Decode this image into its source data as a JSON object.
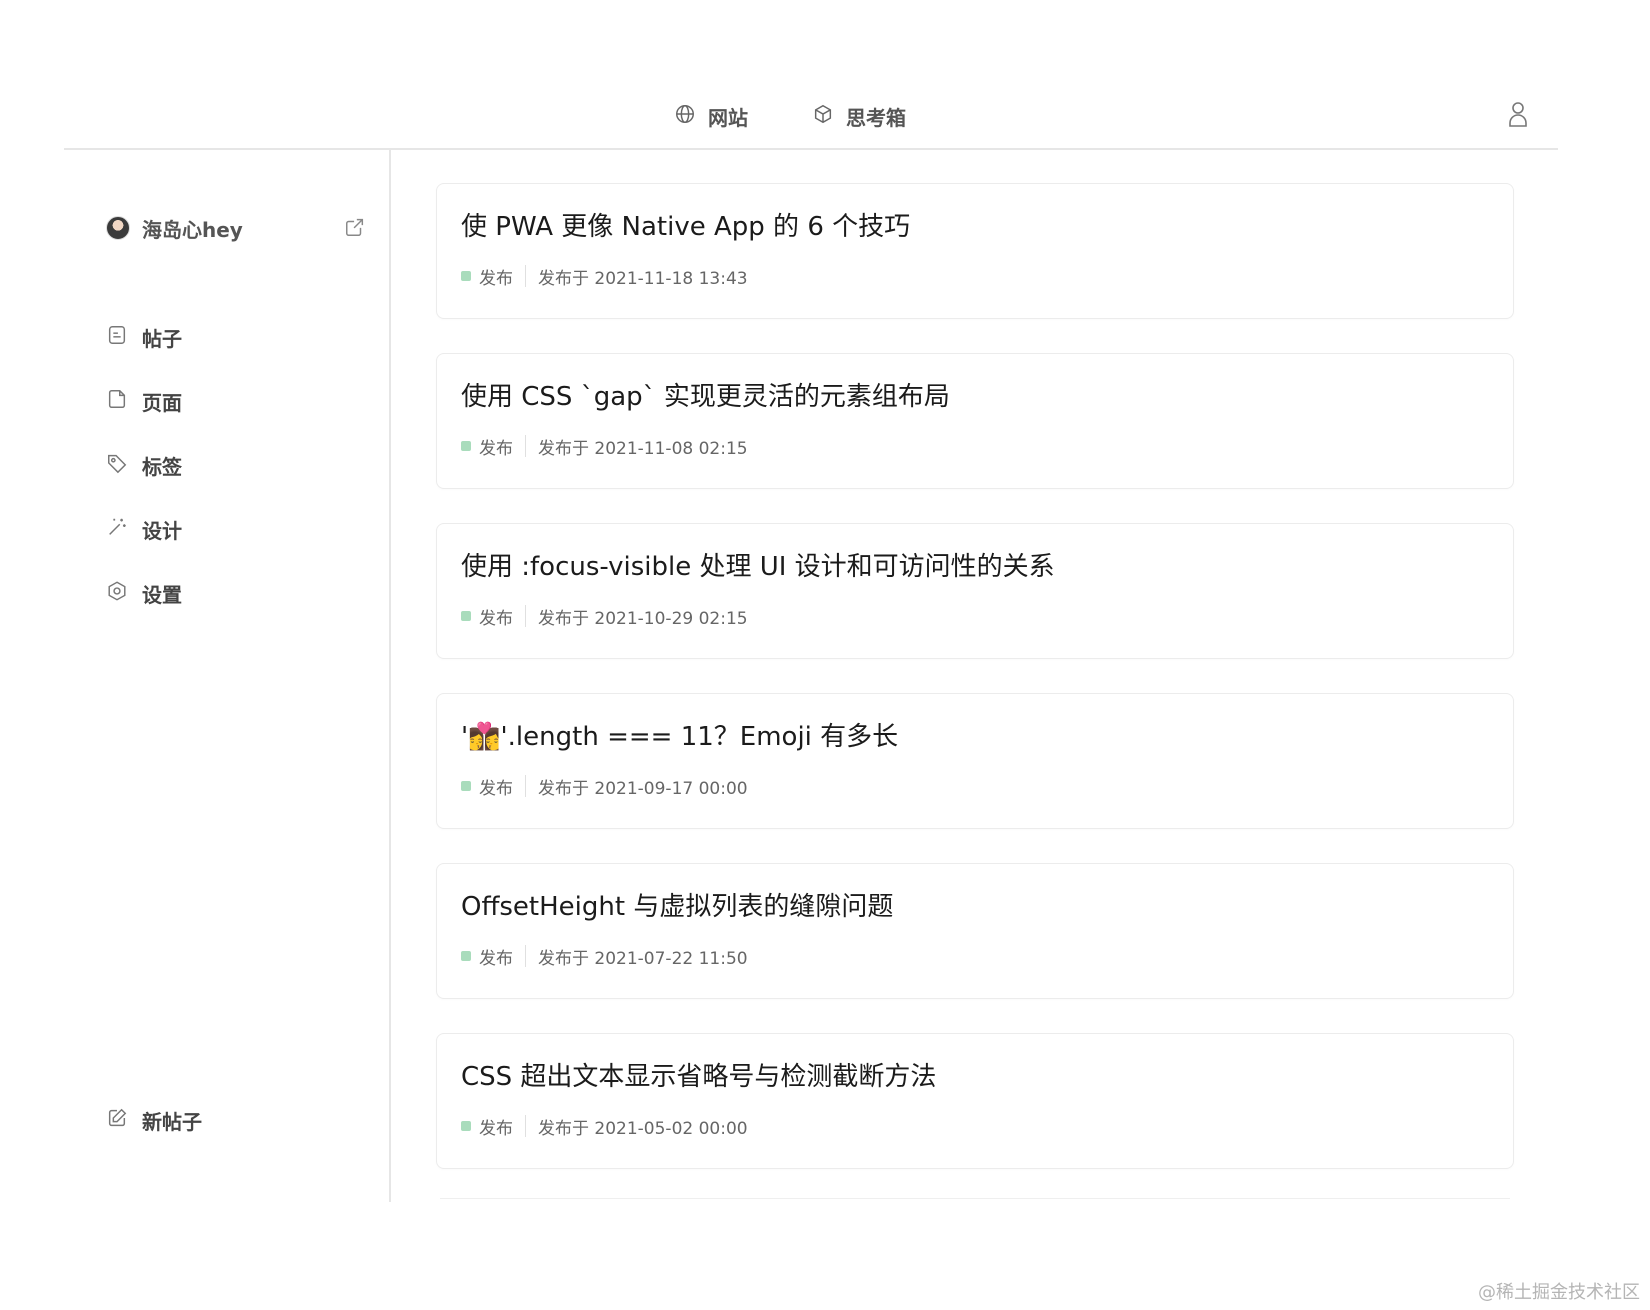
{
  "nav": {
    "items": [
      {
        "label": "网站",
        "icon": "globe-icon"
      },
      {
        "label": "思考箱",
        "icon": "cube-icon"
      }
    ],
    "user_icon": "user-icon"
  },
  "sidebar": {
    "profile": {
      "name": "海岛心hey",
      "action_icon": "external-link-icon"
    },
    "menu": [
      {
        "label": "帖子",
        "icon": "post-icon"
      },
      {
        "label": "页面",
        "icon": "page-icon"
      },
      {
        "label": "标签",
        "icon": "tag-icon"
      },
      {
        "label": "设计",
        "icon": "magic-wand-icon"
      },
      {
        "label": "设置",
        "icon": "settings-icon"
      }
    ],
    "new_post": {
      "label": "新帖子",
      "icon": "edit-icon"
    }
  },
  "posts": [
    {
      "title": "使 PWA 更像 Native App 的 6 个技巧",
      "status": "发布",
      "date": "发布于 2021-11-18 13:43"
    },
    {
      "title": "使用 CSS `gap` 实现更灵活的元素组布局",
      "status": "发布",
      "date": "发布于 2021-11-08 02:15"
    },
    {
      "title": "使用 :focus-visible 处理 UI 设计和可访问性的关系",
      "status": "发布",
      "date": "发布于 2021-10-29 02:15"
    },
    {
      "title": "'👩‍❤️‍💋‍👩'.length === 11？Emoji 有多长",
      "status": "发布",
      "date": "发布于 2021-09-17 00:00"
    },
    {
      "title": "OffsetHeight 与虚拟列表的缝隙问题",
      "status": "发布",
      "date": "发布于 2021-07-22 11:50"
    },
    {
      "title": "CSS 超出文本显示省略号与检测截断方法",
      "status": "发布",
      "date": "发布于 2021-05-02 00:00"
    }
  ],
  "colors": {
    "status_published": "#a9dcbc",
    "divider": "#e6e6e6"
  },
  "watermark": "@稀土掘金技术社区"
}
